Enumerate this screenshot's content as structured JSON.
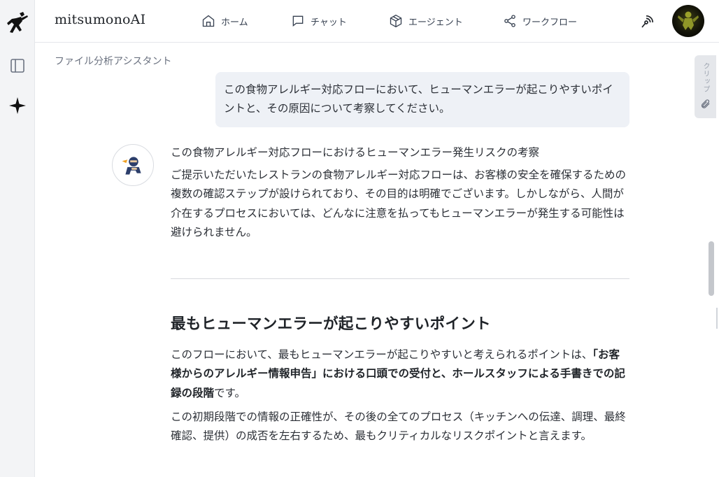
{
  "app": {
    "brand": "mitsumonoAI"
  },
  "nav": {
    "home": "ホーム",
    "chat": "チャット",
    "agent": "エージェント",
    "workflow": "ワークフロー"
  },
  "breadcrumb": "ファイル分析アシスタント",
  "user_message": "この食物アレルギー対応フローにおいて、ヒューマンエラーが起こりやすいポイントと、その原因について考察してください。",
  "answer": {
    "title": "この食物アレルギー対応フローにおけるヒューマンエラー発生リスクの考察",
    "intro": "ご提示いただいたレストランの食物アレルギー対応フローは、お客様の安全を確保するための複数の確認ステップが設けられており、その目的は明確でございます。しかしながら、人間が介在するプロセスにおいては、どんなに注意を払ってもヒューマンエラーが発生する可能性は避けられません。",
    "section_heading": "最もヒューマンエラーが起こりやすいポイント",
    "section_p1_lead": "このフローにおいて、最もヒューマンエラーが起こりやすいと考えられるポイントは、",
    "section_p1_bold": "「お客様からのアレルギー情報申告」における口頭での受付と、ホールスタッフによる手書きでの記録の段階",
    "section_p1_tail": "です。",
    "section_p2": "この初期段階での情報の正確性が、その後の全てのプロセス（キッチンへの伝達、調理、最終確認、提供）の成否を左右するため、最もクリティカルなリスクポイントと言えます。"
  },
  "clip_panel": {
    "label": "クリップ"
  },
  "icons": {
    "logo": "runner-logo-icon",
    "sidebar": "sidebar-toggle-icon",
    "spark": "sparkle-icon",
    "home": "home-icon",
    "chat": "chat-bubble-icon",
    "agent": "cube-icon",
    "workflow": "share-nodes-icon",
    "broadcast": "broadcast-icon",
    "clip": "paperclip-icon"
  },
  "colors": {
    "user_bubble": "#eef1f6",
    "rail": "#f3f4f6"
  }
}
